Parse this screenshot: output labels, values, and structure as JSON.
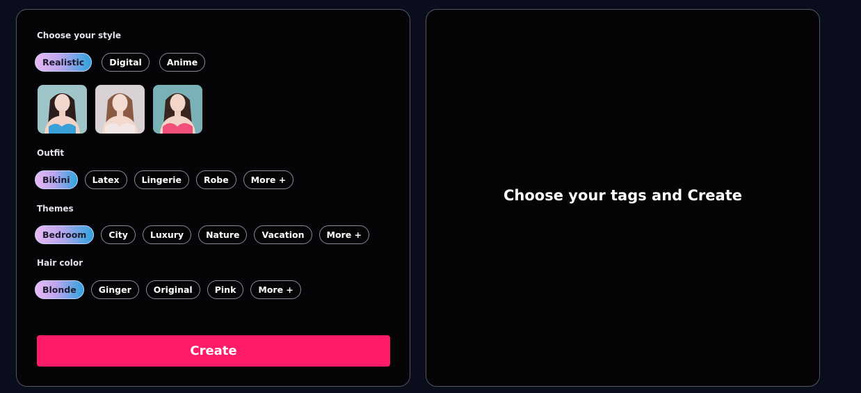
{
  "style_section": {
    "label": "Choose your style",
    "options": [
      "Realistic",
      "Digital",
      "Anime"
    ],
    "selected": "Realistic",
    "thumbnails": [
      {
        "name": "style-thumbnail-1",
        "background": "#9fc5c8",
        "top_color": "#3aa0d8"
      },
      {
        "name": "style-thumbnail-2",
        "background": "#d9d2d4",
        "top_color": "#f3e6e6"
      },
      {
        "name": "style-thumbnail-3",
        "background": "#7ab1b7",
        "top_color": "#f0507a"
      }
    ]
  },
  "outfit_section": {
    "label": "Outfit",
    "options": [
      "Bikini",
      "Latex",
      "Lingerie",
      "Robe",
      "More +"
    ],
    "selected": "Bikini"
  },
  "themes_section": {
    "label": "Themes",
    "options": [
      "Bedroom",
      "City",
      "Luxury",
      "Nature",
      "Vacation",
      "More +"
    ],
    "selected": "Bedroom"
  },
  "hair_section": {
    "label": "Hair color",
    "options": [
      "Blonde",
      "Ginger",
      "Original",
      "Pink",
      "More +"
    ],
    "selected": "Blonde"
  },
  "create_button": {
    "label": "Create"
  },
  "preview": {
    "placeholder": "Choose your tags and Create"
  },
  "colors": {
    "page_background": "#0a0d1c",
    "panel_background": "#050507",
    "accent": "#ff1a6a",
    "chip_gradient": [
      "#e9b9f2",
      "#b9a6ef",
      "#2fa3de"
    ]
  }
}
